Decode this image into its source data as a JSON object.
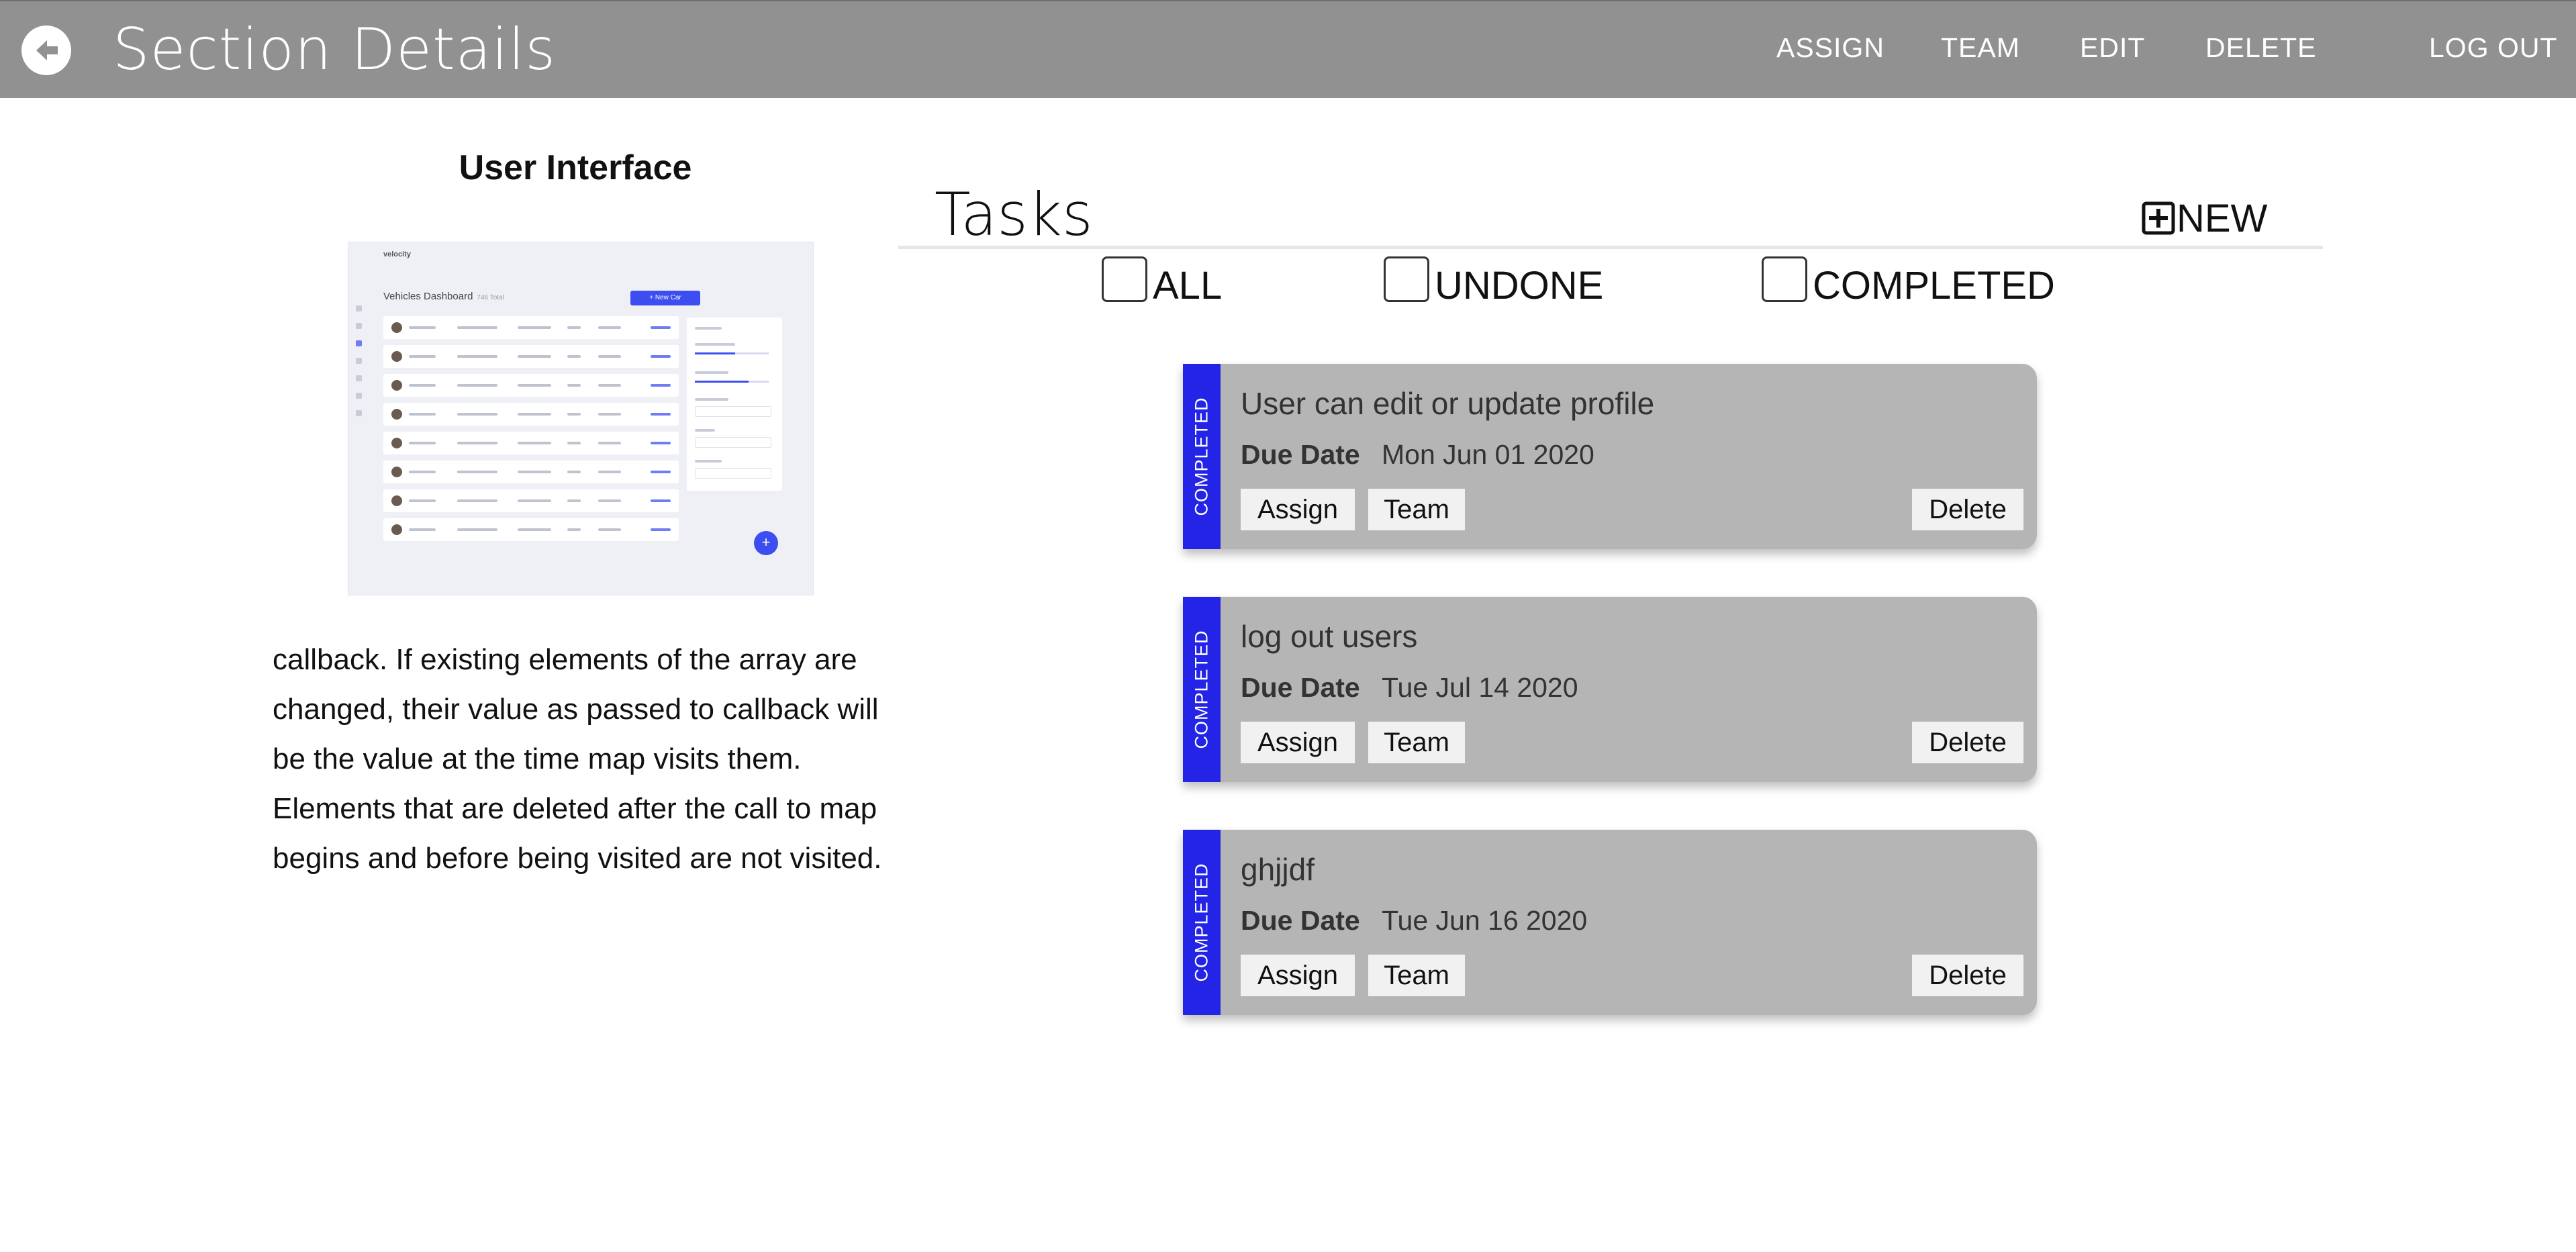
{
  "header": {
    "title": "Section Details",
    "back_icon": "arrow-left-circle-icon",
    "nav": [
      "ASSIGN",
      "TEAM",
      "EDIT",
      "DELETE"
    ],
    "logout": "LOG OUT",
    "bar_color": "#929191"
  },
  "section": {
    "heading": "User Interface",
    "preview": {
      "brand": "velocity",
      "title": "Vehicles Dashboard",
      "subtitle": "746 Total",
      "action_button": "+ New Car",
      "fab": "+"
    },
    "description": "callback. If existing elements of the array are changed, their value as passed to callback will be the value at the time map visits them. Elements that are deleted after the call to map begins and before being visited are not visited."
  },
  "tasks": {
    "title": "Tasks",
    "new_label": "NEW",
    "new_icon": "plus-square-icon",
    "filters": [
      "ALL",
      "UNDONE",
      "COMPLETED"
    ],
    "due_label": "Due Date",
    "status_color": "#2424e6",
    "buttons": {
      "assign": "Assign",
      "team": "Team",
      "delete": "Delete"
    },
    "items": [
      {
        "status": "COMPLETED",
        "title": "User can edit or update profile",
        "due": "Mon Jun 01 2020"
      },
      {
        "status": "COMPLETED",
        "title": "log out users",
        "due": "Tue Jul 14 2020"
      },
      {
        "status": "COMPLETED",
        "title": "ghjjdf",
        "due": "Tue Jun 16 2020"
      }
    ]
  }
}
